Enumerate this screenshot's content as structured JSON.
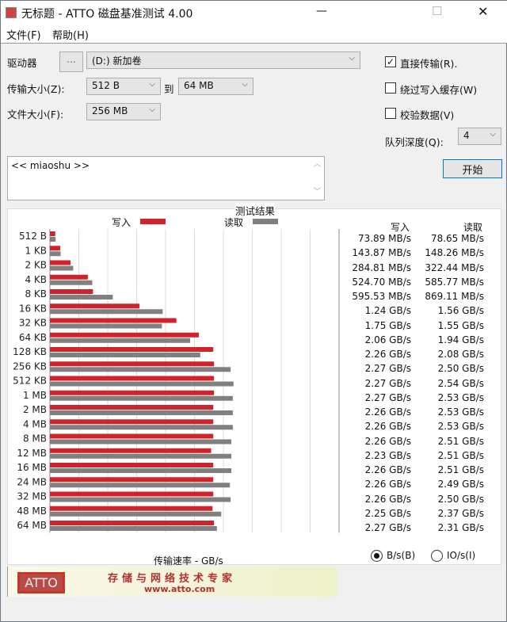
{
  "window": {
    "title": "无标题 - ATTO 磁盘基准测试 4.00",
    "minimize": "—",
    "maximize": "☐",
    "close": "✕"
  },
  "menu": [
    "文件(F)",
    "帮助(H)"
  ],
  "controls": {
    "drive_label": "驱动器",
    "browse_label": "...",
    "drive_value": "(D:) 新加卷",
    "transfer_label": "传输大小(Z):",
    "transfer_from": "512 B",
    "to_label": "到",
    "transfer_to": "64 MB",
    "file_label": "文件大小(F):",
    "file_value": "256 MB",
    "direct_io": {
      "label": "直接传输(R).",
      "checked": true
    },
    "bypass_cache": {
      "label": "绕过写入缓存(W)",
      "checked": false
    },
    "verify": {
      "label": "校验数据(V)",
      "checked": false
    },
    "queue_label": "队列深度(Q):",
    "queue_value": "4",
    "start_label": "开始",
    "description": "<< miaoshu >>"
  },
  "results": {
    "title": "测试结果",
    "write_header": "写入",
    "read_header": "读取",
    "write_values": [
      "73.89 MB/s",
      "143.87 MB/s",
      "284.81 MB/s",
      "524.70 MB/s",
      "595.53 MB/s",
      "1.24 GB/s",
      "1.75 GB/s",
      "2.06 GB/s",
      "2.26 GB/s",
      "2.27 GB/s",
      "2.27 GB/s",
      "2.27 GB/s",
      "2.26 GB/s",
      "2.26 GB/s",
      "2.26 GB/s",
      "2.23 GB/s",
      "2.26 GB/s",
      "2.26 GB/s",
      "2.26 GB/s",
      "2.25 GB/s",
      "2.27 GB/s"
    ],
    "read_values": [
      "78.65 MB/s",
      "148.26 MB/s",
      "322.44 MB/s",
      "585.77 MB/s",
      "869.11 MB/s",
      "1.56 GB/s",
      "1.55 GB/s",
      "1.94 GB/s",
      "2.08 GB/s",
      "2.50 GB/s",
      "2.54 GB/s",
      "2.53 GB/s",
      "2.53 GB/s",
      "2.53 GB/s",
      "2.51 GB/s",
      "2.51 GB/s",
      "2.51 GB/s",
      "2.49 GB/s",
      "2.50 GB/s",
      "2.37 GB/s",
      "2.31 GB/s"
    ],
    "unit_bytes": "B/s(B)",
    "unit_io": "IO/s(I)",
    "unit_selected": "bytes"
  },
  "chart_data": {
    "type": "bar",
    "orientation": "horizontal",
    "title": "测试结果",
    "xlabel": "传输速率 - GB/s",
    "xlim": [
      0,
      4
    ],
    "xticks": [
      "0",
      "0.4",
      "0.8",
      "1.2",
      "1.6",
      "2",
      "2.4",
      "2.8",
      "3.2",
      "3.6",
      "4"
    ],
    "categories": [
      "512 B",
      "1 KB",
      "2 KB",
      "4 KB",
      "8 KB",
      "16 KB",
      "32 KB",
      "64 KB",
      "128 KB",
      "256 KB",
      "512 KB",
      "1 MB",
      "2 MB",
      "4 MB",
      "8 MB",
      "12 MB",
      "16 MB",
      "24 MB",
      "32 MB",
      "48 MB",
      "64 MB"
    ],
    "series": [
      {
        "name": "写入",
        "color": "#d0232b",
        "values": [
          0.0739,
          0.1439,
          0.2848,
          0.5247,
          0.5955,
          1.24,
          1.75,
          2.06,
          2.26,
          2.27,
          2.27,
          2.27,
          2.26,
          2.26,
          2.26,
          2.23,
          2.26,
          2.26,
          2.26,
          2.25,
          2.27
        ]
      },
      {
        "name": "读取",
        "color": "#808080",
        "values": [
          0.0787,
          0.1483,
          0.3224,
          0.5858,
          0.8691,
          1.56,
          1.55,
          1.94,
          2.08,
          2.5,
          2.54,
          2.53,
          2.53,
          2.53,
          2.51,
          2.51,
          2.51,
          2.49,
          2.5,
          2.37,
          2.31
        ]
      }
    ],
    "grid": true,
    "legend": "top"
  },
  "banner": {
    "logo": "ATTO",
    "slogan": "存储与网络技术专家",
    "url": "www.atto.com"
  }
}
